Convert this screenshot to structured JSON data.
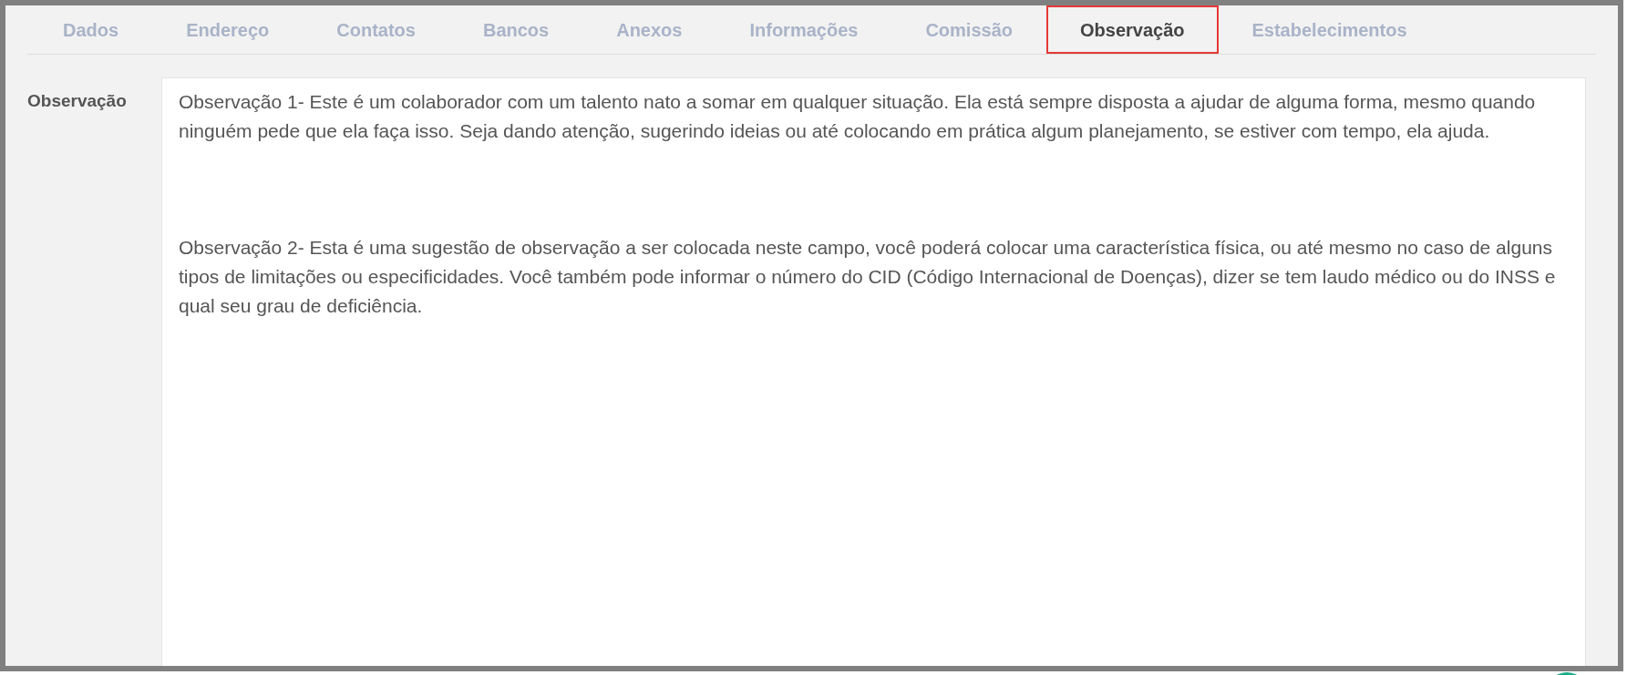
{
  "tabs": [
    {
      "label": "Dados",
      "selected": false
    },
    {
      "label": "Endereço",
      "selected": false
    },
    {
      "label": "Contatos",
      "selected": false
    },
    {
      "label": "Bancos",
      "selected": false
    },
    {
      "label": "Anexos",
      "selected": false
    },
    {
      "label": "Informações",
      "selected": false
    },
    {
      "label": "Comissão",
      "selected": false
    },
    {
      "label": "Observação",
      "selected": true
    },
    {
      "label": "Estabelecimentos",
      "selected": false
    }
  ],
  "field": {
    "label": "Observação",
    "value": "Observação 1- Este é um colaborador com um talento nato a somar em qualquer situação. Ela está sempre disposta a ajudar de alguma forma, mesmo quando ninguém pede que ela faça isso. Seja dando atenção, sugerindo ideias ou até colocando em prática algum planejamento, se estiver com tempo, ela ajuda.\n\n\n\nObservação 2- Esta é uma sugestão de observação a ser colocada neste campo, você poderá colocar uma característica física, ou até mesmo no caso de alguns tipos de limitações ou especificidades. Você também pode informar o número do CID (Código Internacional de Doenças), dizer se tem laudo médico ou do INSS e qual seu grau de deficiência."
  }
}
